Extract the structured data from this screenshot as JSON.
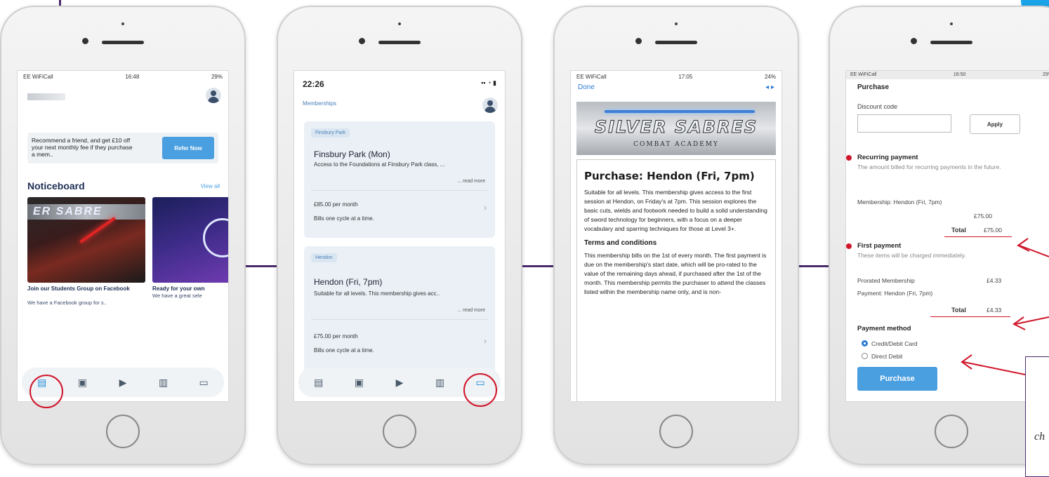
{
  "phone1": {
    "status_left": "EE WiFiCall",
    "status_time": "16:48",
    "status_right": "29%",
    "refer_text": "Recommend a friend, and get £10 off your next monthly fee if they purchase a mem..",
    "refer_button": "Refer Now",
    "noticeboard_title": "Noticeboard",
    "view_all": "View all",
    "card1_banner": "ER SABRE",
    "card1_title": "Join our Students Group on Facebook",
    "card1_sub": "We have a Facebook group for s..",
    "card2_title": "Ready for your own",
    "card2_sub": "We have a great sele",
    "tabs": [
      "document-icon",
      "calendar-icon",
      "video-icon",
      "chart-icon",
      "monitor-icon"
    ]
  },
  "phone2": {
    "time": "22:26",
    "title": "Memberships",
    "memberships": [
      {
        "tag": "Finsbury Park",
        "name": "Finsbury Park (Mon)",
        "desc": "Access to the Foundations at Finsbury Park class, ...",
        "read_more": "... read more",
        "price": "£85.00 per month",
        "cycle": "Bills one cycle at a time."
      },
      {
        "tag": "Hendon",
        "name": "Hendon (Fri, 7pm)",
        "desc": "Suitable for all levels. This membership gives acc..",
        "read_more": "... read more",
        "price": "£75.00 per month",
        "cycle": "Bills one cycle at a time."
      }
    ]
  },
  "phone3": {
    "status_left": "EE WiFiCall",
    "status_time": "17:05",
    "status_right": "24%",
    "done": "Done",
    "logo_main": "SILVER SABRES",
    "logo_sub": "COMBAT ACADEMY",
    "title": "Purchase: Hendon (Fri, 7pm)",
    "body": "Suitable for all levels. This membership gives access to the first session at Hendon, on Friday's at 7pm. This session explores the basic cuts, wields and footwork needed to build a solid understanding of sword technology for beginners, with a focus on a deeper vocabulary and sparring techniques for those at Level 3+.",
    "terms_title": "Terms and conditions",
    "terms_body": "This membership bills on the 1st of every month. The first payment is due on the membership's start date, which will be pro-rated to the value of the remaining days ahead, if purchased after the 1st of the month. This membership permits the purchaser to attend the classes listed within the membership name only, and is non-"
  },
  "phone4": {
    "status_left": "EE WiFiCall",
    "status_time": "16:50",
    "status_right": "29%",
    "heading": "Purchase",
    "discount_label": "Discount code",
    "apply": "Apply",
    "recurring_title": "Recurring payment",
    "recurring_desc": "The amount billed for recurring payments in the future.",
    "recurring_item": "Membership: Hendon (Fri, 7pm)",
    "recurring_amount": "£75.00",
    "total_label": "Total",
    "recurring_total": "£75.00",
    "first_title": "First payment",
    "first_desc": "These items will be charged immediately.",
    "first_item_line1": "Prorated Membership",
    "first_item_line2": "Payment: Hendon (Fri, 7pm)",
    "first_amount": "£4.33",
    "first_total": "£4.33",
    "method_title": "Payment method",
    "method_card": "Credit/Debit Card",
    "method_debit": "Direct Debit",
    "purchase_button": "Purchase"
  },
  "callout_text": "ch"
}
